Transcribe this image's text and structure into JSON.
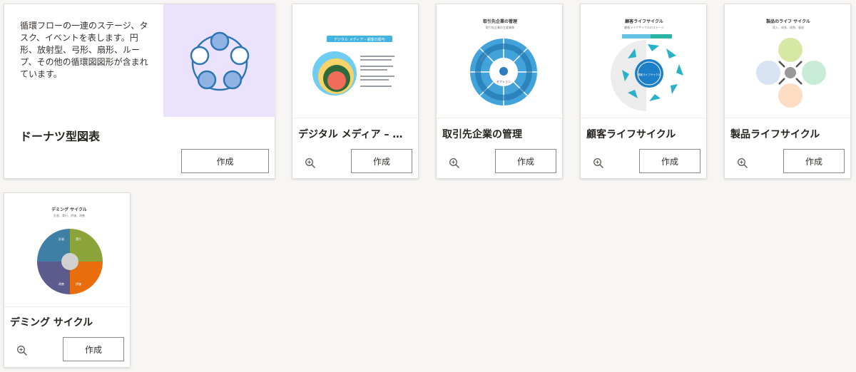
{
  "featured": {
    "description": "循環フローの一連のステージ、タスク、イベントを表します。円形、放射型、弓形、扇形、ループ、その他の循環図図形が含まれています。",
    "title": "ドーナツ型図表",
    "create_label": "作成"
  },
  "cards": [
    {
      "title": "デジタル メディア – 顧...",
      "create_label": "作成",
      "thumb_header": "デジタル メディア – 顧客の関与"
    },
    {
      "title": "取引先企業の管理",
      "create_label": "作成",
      "thumb_title": "取引先企業の管理",
      "thumb_subtitle": "取引先企業の主要業務",
      "thumb_center": "セクション"
    },
    {
      "title": "顧客ライフサイクル",
      "create_label": "作成",
      "thumb_title": "顧客ライフサイクル",
      "thumb_subtitle": "顧客ライフサイクルのステージ",
      "thumb_center": "顧客ライフサイクル"
    },
    {
      "title": "製品ライフサイクル",
      "create_label": "作成",
      "thumb_title": "製品のライフ サイクル",
      "thumb_subtitle": "導入、成長、成熟、衰退"
    },
    {
      "title": "デミング サイクル",
      "create_label": "作成",
      "thumb_title": "デミング サイクル",
      "thumb_subtitle": "計画、実行、評価、改善",
      "quadrants": [
        "計画",
        "実行",
        "評価",
        "改善"
      ]
    }
  ],
  "colors": {
    "featured_thumb_bg": "#ebe3fd",
    "ring_stroke": "#2e75b6",
    "ring_fill": "#8fb4e3"
  },
  "icons": {
    "zoom": "zoom-in-icon"
  }
}
